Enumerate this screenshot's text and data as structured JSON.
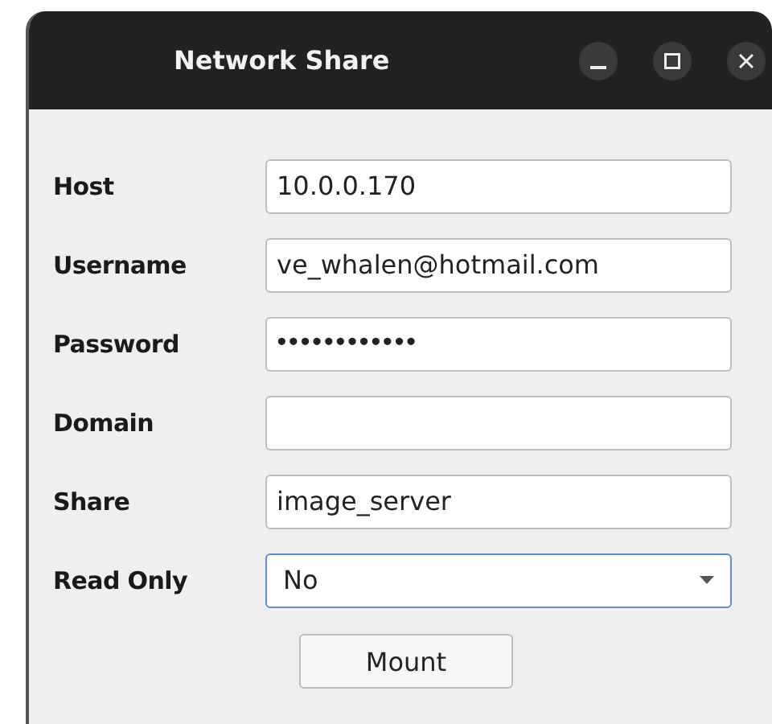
{
  "window": {
    "title": "Network Share",
    "controls": [
      {
        "kind": "minimize"
      },
      {
        "kind": "maximize"
      },
      {
        "kind": "close"
      }
    ]
  },
  "fields": [
    {
      "label": "Host",
      "kind": "text",
      "value": "10.0.0.170"
    },
    {
      "label": "Username",
      "kind": "text",
      "value": "ve_whalen@hotmail.com"
    },
    {
      "label": "Password",
      "kind": "password",
      "value": "••••••••••••"
    },
    {
      "label": "Domain",
      "kind": "text"
    },
    {
      "label": "Share",
      "kind": "text",
      "value": "image_server"
    },
    {
      "label": "Read Only",
      "kind": "select",
      "value": "No",
      "focused": true
    }
  ],
  "buttons": [
    {
      "label": "Mount"
    }
  ]
}
